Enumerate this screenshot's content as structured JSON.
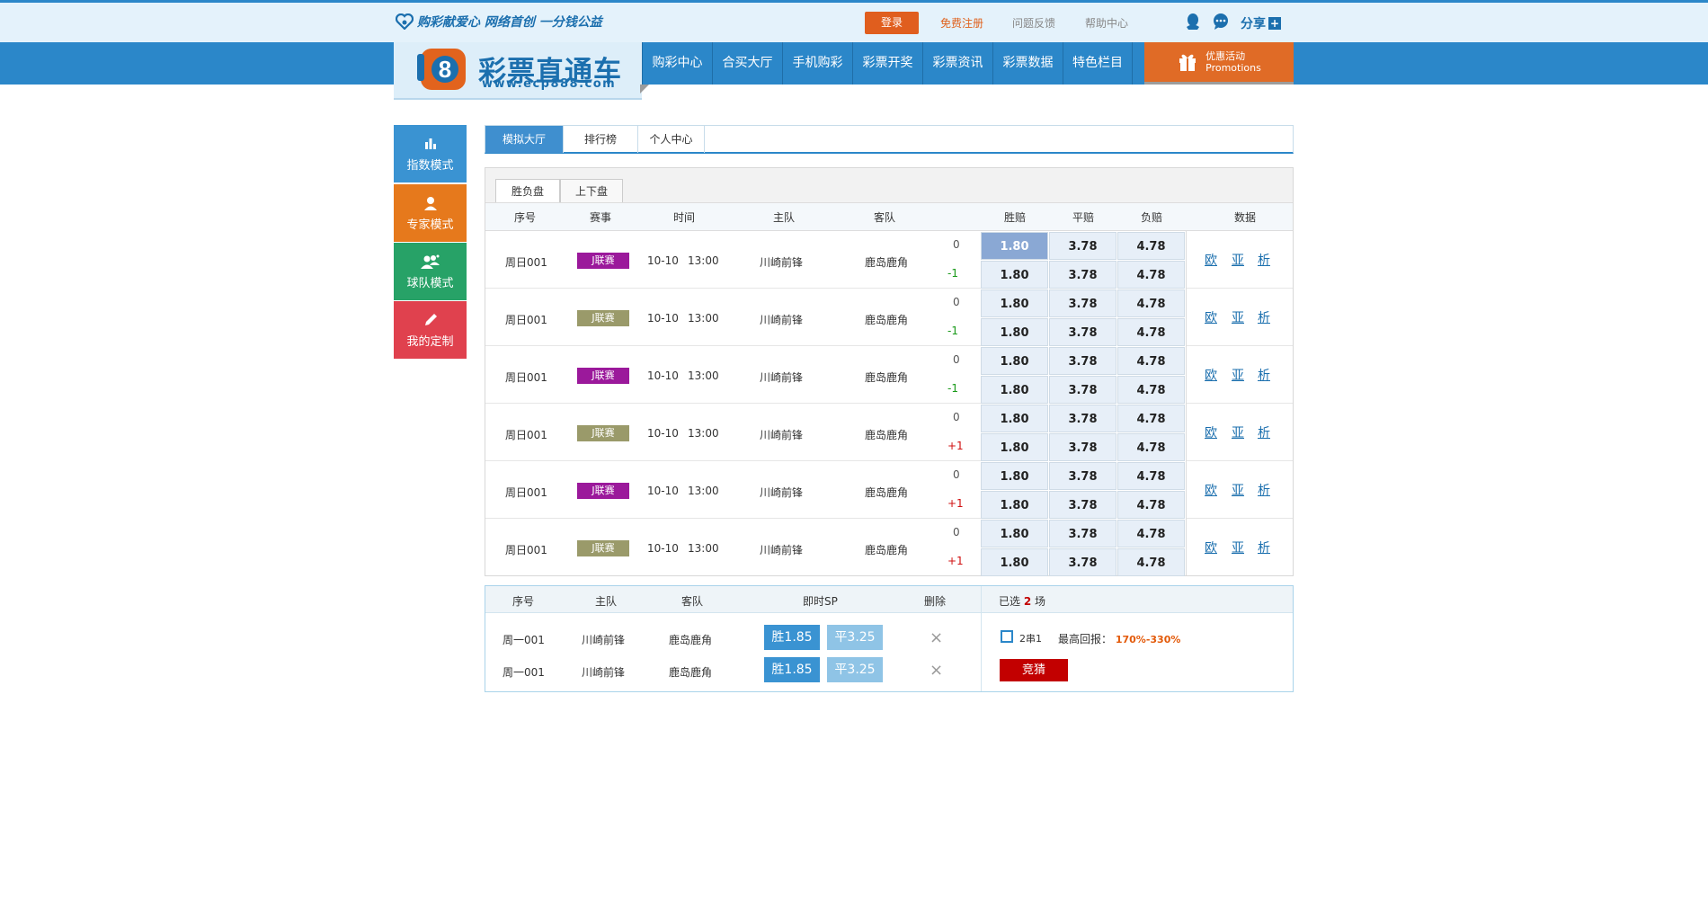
{
  "header": {
    "slogan": "购彩献爱心 网络首创 一分钱公益",
    "login_label": "登录",
    "register_label": "免费注册",
    "feedback_label": "问题反馈",
    "help_label": "帮助中心",
    "share_label": "分享",
    "plus_symbol": "+"
  },
  "logo": {
    "badge_char": "8",
    "name": "彩票直通车",
    "url": "www.ecp888.com"
  },
  "nav": {
    "items": [
      "购彩中心",
      "合买大厅",
      "手机购彩",
      "彩票开奖",
      "彩票资讯",
      "彩票数据",
      "特色栏目"
    ],
    "promo_title": "优惠活动",
    "promo_sub": "Promotions"
  },
  "side_menu": [
    {
      "label": "指数模式",
      "icon": "bar-chart-icon",
      "color": "#3a93d2"
    },
    {
      "label": "专家模式",
      "icon": "user-icon",
      "color": "#e6791c"
    },
    {
      "label": "球队模式",
      "icon": "team-icon",
      "color": "#27a267"
    },
    {
      "label": "我的定制",
      "icon": "pencil-icon",
      "color": "#e0414e"
    }
  ],
  "tabs": [
    "模拟大厅",
    "排行榜",
    "个人中心"
  ],
  "subtabs": [
    "胜负盘",
    "上下盘"
  ],
  "table_headers": {
    "no": "序号",
    "league": "赛事",
    "time": "时间",
    "home": "主队",
    "away": "客队",
    "win": "胜赔",
    "draw": "平赔",
    "lose": "负赔",
    "data": "数据"
  },
  "matches": [
    {
      "no": "周日001",
      "league": "J联赛",
      "league_color": "#9b199b",
      "date": "10-10",
      "time": "13:00",
      "home": "川崎前锋",
      "away": "鹿岛鹿角",
      "h1": "0",
      "h2": "-1",
      "h2_color": "#1a9a1a",
      "odds1": [
        "1.80",
        "3.78",
        "4.78"
      ],
      "odds2": [
        "1.80",
        "3.78",
        "4.78"
      ],
      "links": [
        "欧",
        "亚",
        "析"
      ]
    },
    {
      "no": "周日001",
      "league": "J联赛",
      "league_color": "#9a9a6a",
      "date": "10-10",
      "time": "13:00",
      "home": "川崎前锋",
      "away": "鹿岛鹿角",
      "h1": "0",
      "h2": "-1",
      "h2_color": "#1a9a1a",
      "odds1": [
        "1.80",
        "3.78",
        "4.78"
      ],
      "odds2": [
        "1.80",
        "3.78",
        "4.78"
      ],
      "links": [
        "欧",
        "亚",
        "析"
      ]
    },
    {
      "no": "周日001",
      "league": "J联赛",
      "league_color": "#9b199b",
      "date": "10-10",
      "time": "13:00",
      "home": "川崎前锋",
      "away": "鹿岛鹿角",
      "h1": "0",
      "h2": "-1",
      "h2_color": "#1a9a1a",
      "odds1": [
        "1.80",
        "3.78",
        "4.78"
      ],
      "odds2": [
        "1.80",
        "3.78",
        "4.78"
      ],
      "links": [
        "欧",
        "亚",
        "析"
      ]
    },
    {
      "no": "周日001",
      "league": "J联赛",
      "league_color": "#9a9a6a",
      "date": "10-10",
      "time": "13:00",
      "home": "川崎前锋",
      "away": "鹿岛鹿角",
      "h1": "0",
      "h2": "+1",
      "h2_color": "#d01010",
      "odds1": [
        "1.80",
        "3.78",
        "4.78"
      ],
      "odds2": [
        "1.80",
        "3.78",
        "4.78"
      ],
      "links": [
        "欧",
        "亚",
        "析"
      ]
    },
    {
      "no": "周日001",
      "league": "J联赛",
      "league_color": "#9b199b",
      "date": "10-10",
      "time": "13:00",
      "home": "川崎前锋",
      "away": "鹿岛鹿角",
      "h1": "0",
      "h2": "+1",
      "h2_color": "#d01010",
      "odds1": [
        "1.80",
        "3.78",
        "4.78"
      ],
      "odds2": [
        "1.80",
        "3.78",
        "4.78"
      ],
      "links": [
        "欧",
        "亚",
        "析"
      ]
    },
    {
      "no": "周日001",
      "league": "J联赛",
      "league_color": "#9a9a6a",
      "date": "10-10",
      "time": "13:00",
      "home": "川崎前锋",
      "away": "鹿岛鹿角",
      "h1": "0",
      "h2": "+1",
      "h2_color": "#d01010",
      "odds1": [
        "1.80",
        "3.78",
        "4.78"
      ],
      "odds2": [
        "1.80",
        "3.78",
        "4.78"
      ],
      "links": [
        "欧",
        "亚",
        "析"
      ]
    }
  ],
  "selection": {
    "headers": {
      "no": "序号",
      "home": "主队",
      "away": "客队",
      "sp": "即时SP",
      "delete": "删除"
    },
    "rows": [
      {
        "no": "周一001",
        "home": "川崎前锋",
        "away": "鹿岛鹿角",
        "win": "胜1.85",
        "draw": "平3.25",
        "delete": "×"
      },
      {
        "no": "周一001",
        "home": "川崎前锋",
        "away": "鹿岛鹿角",
        "win": "胜1.85",
        "draw": "平3.25",
        "delete": "×"
      }
    ],
    "selected_prefix": "已选",
    "selected_count": "2",
    "selected_suffix": "场",
    "pass_type": "2串1",
    "max_return_label": "最高回报：",
    "max_return_value": "170%-330%",
    "guess_label": "竞猜"
  }
}
